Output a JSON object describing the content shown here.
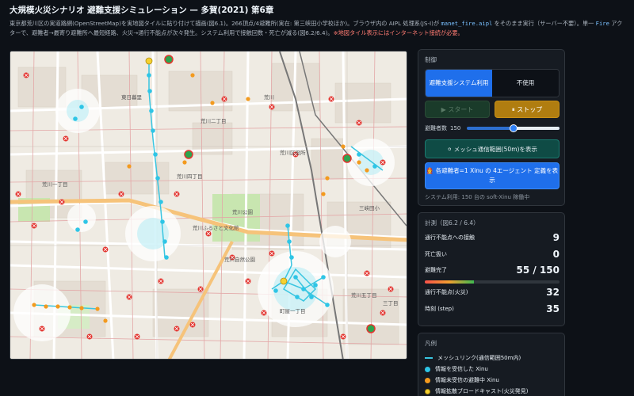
{
  "header": {
    "title": "大規模火災シナリオ 避難支援シミュレーション — 多賀(2021) 第6章",
    "desc_part1": "東京都荒川区の実道路網(OpenStreetMap)を実地図タイルに貼り付けて描画(図6.1)。266頂点/4避難所(実在: 第三峡田小学校ほか)。ブラウザ内の AIPL 処理系(JS-I)が ",
    "desc_code1": "manet_fire.aipl",
    "desc_part2": " をそのまま実行（サーバー不要）。単一 ",
    "desc_code2": "Fire",
    "desc_part3": " アクターで、避難者→最寄り避難所へ最短経路、火災→通行不能点が次々発生。システム利用で接触回数・死亡が減る(図6.2/6.4)。",
    "desc_warn": "※地図タイル表示にはインターネット接続が必要。"
  },
  "map": {
    "labels": [
      "荒川区役所",
      "荒川公園",
      "荒川ふるさと文化館",
      "荒川",
      "三丁目",
      "荒川二丁目",
      "荒川四丁目",
      "荒川五丁目",
      "荒川一丁目",
      "町屋一丁目",
      "東日暮里",
      "荒川自然公園",
      "三峡田小"
    ],
    "colors": {
      "mesh": "#39c5e0",
      "received": "#2ec5e6",
      "unreceived": "#f39a1e",
      "broadcast": "#f5d130",
      "fire": "#e3342f",
      "shelter": "#2ea44f"
    }
  },
  "control": {
    "title": "制御",
    "toggle_on": "避難支援システム利用",
    "toggle_off": "不使用",
    "start": "▶ スタート",
    "stop": "⏸ ストップ",
    "evacuee_label": "避難者数",
    "evacuee_value": "150",
    "evacuee_fraction": 0.5,
    "mesh_button": "⚪ メッシュ通信範囲(50m)を表示",
    "agent_button": "🧑‍🚒 各避難者=1 Xinu の 4エージェント 定義を表示",
    "sys_note": "システム利用: 150 台の soft-Xinu 稼働中"
  },
  "stats": {
    "title": "計測（図6.2 / 6.4）",
    "contact_label": "通行不能点への接触",
    "contact_value": "9",
    "death_label": "死亡扱い",
    "death_value": "0",
    "done_label": "避難完了",
    "done_value": "55 / 150",
    "done_fraction": 0.3667,
    "fire_label": "通行不能点(火災)",
    "fire_value": "32",
    "time_label": "時刻 (step)",
    "time_value": "35"
  },
  "legend": {
    "title": "凡例",
    "items": [
      {
        "label": "メッシュリンク(通信範囲50m内)",
        "kind": "line",
        "color": "#39c5e0"
      },
      {
        "label": "情報を受信した Xinu",
        "kind": "dot",
        "color": "#2ec5e6"
      },
      {
        "label": "情報未受信の避難中 Xinu",
        "kind": "dot",
        "color": "#f39a1e"
      },
      {
        "label": "情報拡散ブロードキャスト(火災発見)",
        "kind": "dot",
        "color": "#f5d130"
      }
    ]
  }
}
